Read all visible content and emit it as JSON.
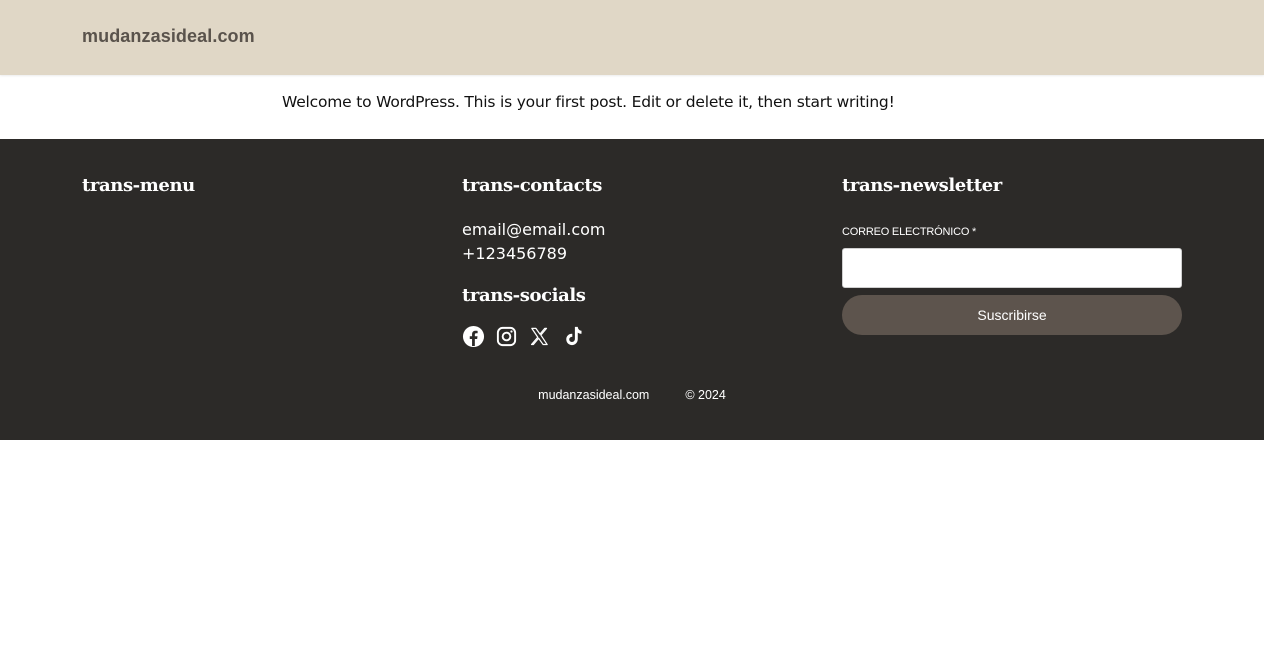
{
  "header": {
    "site_title": "mudanzasideal.com",
    "background": "#e0d7c6"
  },
  "post": {
    "text": "Welcome to WordPress. This is your first post. Edit or delete it, then start writing!"
  },
  "footer": {
    "background": "#2c2a28",
    "menu": {
      "title": "trans-menu"
    },
    "contacts": {
      "title": "trans-contacts",
      "email": "email@email.com",
      "phone": "+123456789"
    },
    "socials": {
      "title": "trans-socials",
      "icons": [
        "facebook-icon",
        "instagram-icon",
        "x-icon",
        "tiktok-icon"
      ]
    },
    "newsletter": {
      "title": "trans-newsletter",
      "email_label": "CORREO ELECTRÓNICO *",
      "email_value": "",
      "submit_label": "Suscribirse",
      "button_color": "#5d544d"
    },
    "bottom": {
      "site_name": "mudanzasideal.com",
      "copyright": "© 2024"
    }
  }
}
